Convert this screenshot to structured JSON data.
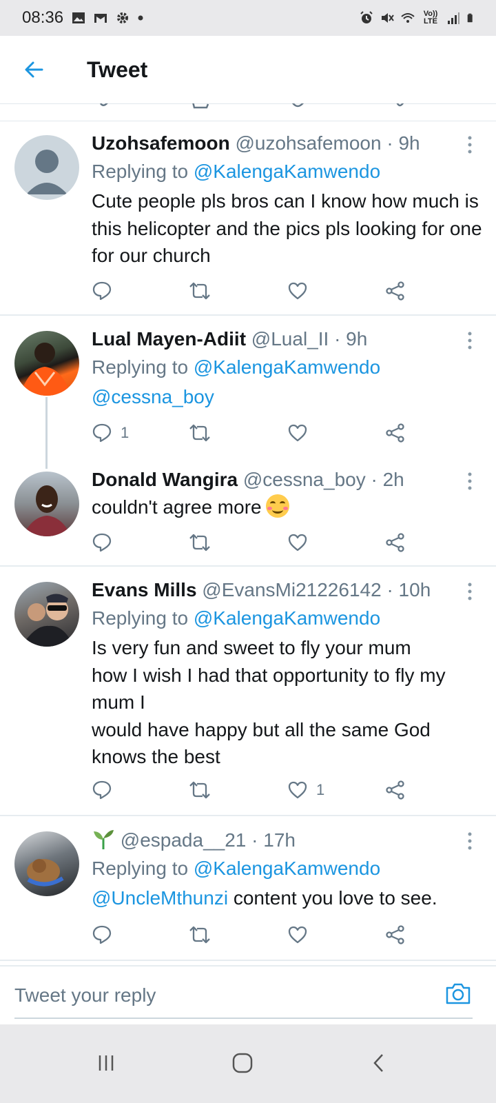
{
  "status_bar": {
    "time": "08:36",
    "icons_left": [
      "gallery-icon",
      "gmail-icon",
      "settings-icon",
      "dot-icon"
    ],
    "icons_right": [
      "alarm-icon",
      "mute-icon",
      "wifi-icon",
      "volte-icon",
      "signal-icon",
      "battery-icon"
    ],
    "volte_label": "Vo)) LTE"
  },
  "header": {
    "title": "Tweet",
    "back_icon": "arrow-left-icon"
  },
  "tweets": [
    {
      "name": "Uzohsafemoon",
      "handle": "@uzohsafemoon",
      "time": "· 9h",
      "replying_prefix": "Replying to",
      "replying_to": "@KalengaKamwendo",
      "text": "Cute people pls bros can I know how much is this helicopter and the pics pls looking for one for our church",
      "reply_count": "",
      "like_count": ""
    },
    {
      "name": "Lual Mayen-Adiit",
      "handle": "@Lual_II",
      "time": "· 9h",
      "replying_prefix": "Replying to",
      "replying_to": "@KalengaKamwendo",
      "mention": "@cessna_boy",
      "reply_count": "1",
      "like_count": ""
    },
    {
      "name": "Donald Wangira",
      "handle": "@cessna_boy",
      "time": "· 2h",
      "text": "couldn't agree more",
      "emoji": "smiling-face-with-smiling-eyes"
    },
    {
      "name": "Evans Mills",
      "handle": "@EvansMi21226142",
      "time": "· 10h",
      "replying_prefix": "Replying to",
      "replying_to": "@KalengaKamwendo",
      "text_lines": [
        "Is very fun and sweet to fly your mum",
        "how I wish I had that opportunity to fly my",
        "mum I",
        "would have happy but all the same God",
        "knows the best"
      ],
      "like_count": "1"
    },
    {
      "name_emoji": "seedling-icon",
      "handle": "@espada__21",
      "time": "· 17h",
      "replying_prefix": "Replying to",
      "replying_to": "@KalengaKamwendo",
      "mention": "@UncleMthunzi",
      "text": "content you love to see."
    }
  ],
  "composer": {
    "placeholder": "Tweet your reply",
    "camera_icon": "camera-icon"
  },
  "nav_bar": {
    "buttons": [
      "recents-icon",
      "home-icon",
      "back-icon"
    ]
  },
  "colors": {
    "accent": "#1b95e0",
    "text": "#14171a",
    "secondary": "#657786",
    "divider": "#e6ecf0",
    "system_bar": "#e9e9eb"
  }
}
